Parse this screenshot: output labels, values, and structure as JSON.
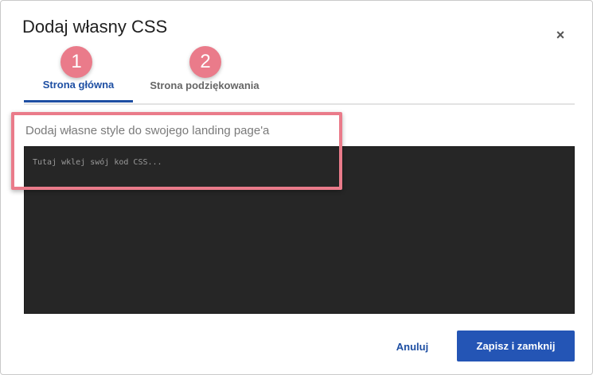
{
  "dialog": {
    "title": "Dodaj własny CSS",
    "close_glyph": "×"
  },
  "tabs": [
    {
      "label": "Strona główna",
      "active": true,
      "badge": "1"
    },
    {
      "label": "Strona podziękowania",
      "active": false,
      "badge": "2"
    }
  ],
  "editor": {
    "description": "Dodaj własne style do swojego landing page'a",
    "placeholder": "Tutaj wklej swój kod CSS...",
    "value": ""
  },
  "footer": {
    "cancel_label": "Anuluj",
    "save_label": "Zapisz i zamknij"
  },
  "colors": {
    "accent": "#1e4fa3",
    "primary_button": "#2455b5",
    "annotation": "#ea7b8a",
    "editor_bg": "#262626"
  }
}
